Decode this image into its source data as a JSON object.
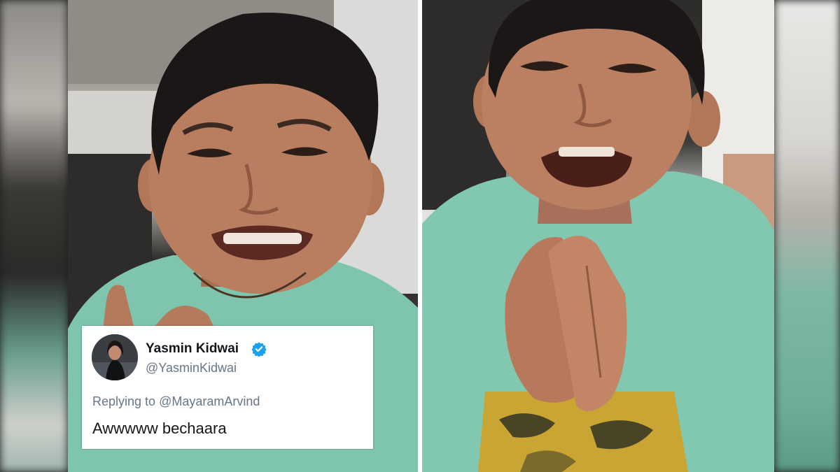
{
  "tweet": {
    "name": "Yasmin Kidwai",
    "handle": "@YasminKidwai",
    "replying_prefix": "Replying to",
    "replying_to": "@MayaramArvind",
    "text": "Awwwww bechaara",
    "verified_icon": "verified-badge-icon",
    "verified_color": "#1da1f2"
  },
  "colors": {
    "shirt": "#7fc4ad",
    "hair": "#1a1716",
    "skin": "#b47a5d",
    "background_left": "#1c1c1c"
  }
}
